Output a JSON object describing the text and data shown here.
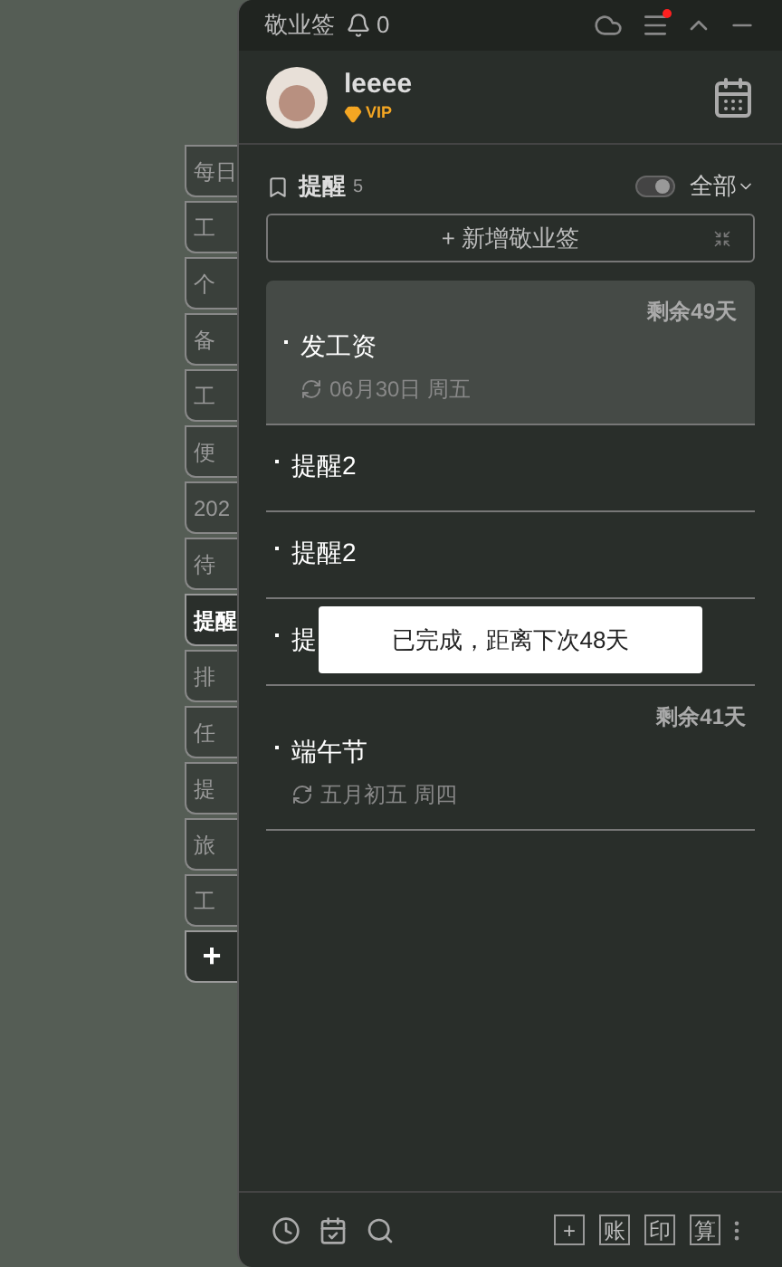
{
  "side_tabs": [
    {
      "label": "每日",
      "selected": false
    },
    {
      "label": "工",
      "selected": false
    },
    {
      "label": "个",
      "selected": false
    },
    {
      "label": "备",
      "selected": false
    },
    {
      "label": "工",
      "selected": false
    },
    {
      "label": "便",
      "selected": false
    },
    {
      "label": "202",
      "selected": false
    },
    {
      "label": "待",
      "selected": false
    },
    {
      "label": "提醒",
      "selected": true
    },
    {
      "label": "排",
      "selected": false
    },
    {
      "label": "任",
      "selected": false
    },
    {
      "label": "提",
      "selected": false
    },
    {
      "label": "旅",
      "selected": false
    },
    {
      "label": "工",
      "selected": false
    }
  ],
  "add_tab": "+",
  "title_bar": {
    "title": "敬业签",
    "notifications": "0",
    "menu_badge": true
  },
  "user": {
    "name": "leeee",
    "badge": "VIP"
  },
  "list_header": {
    "title": "提醒",
    "count": "5",
    "toggle_on": true,
    "filter": "全部"
  },
  "new_button": "+ 新增敬业签",
  "items": [
    {
      "remaining": "剩余49天",
      "title": "发工资",
      "repeat": "06月30日 周五",
      "selected": true
    },
    {
      "title": "提醒2",
      "selected": false
    },
    {
      "title": "提醒2",
      "selected": false
    },
    {
      "title": "提",
      "selected": false,
      "toast": "已完成，距离下次48天"
    },
    {
      "remaining": "剩余41天",
      "title": "端午节",
      "repeat": "五月初五 周四",
      "selected": false
    }
  ],
  "footer_buttons": [
    "+",
    "账",
    "印",
    "算"
  ]
}
